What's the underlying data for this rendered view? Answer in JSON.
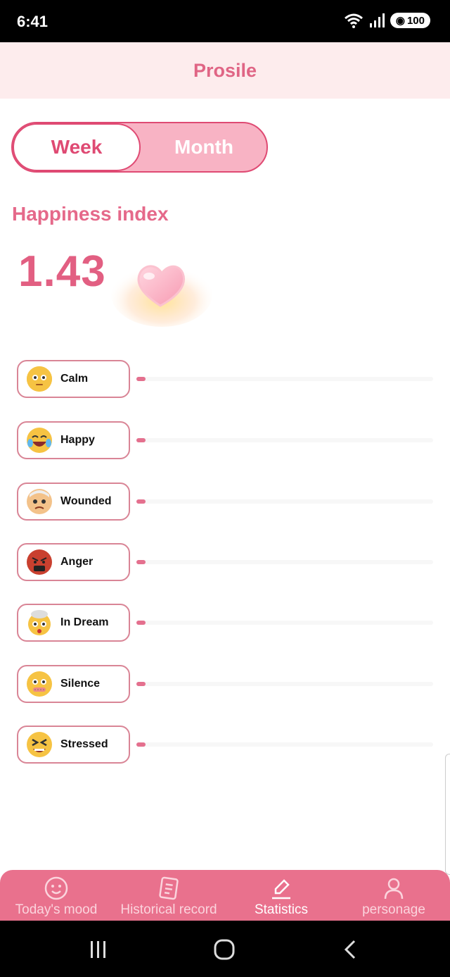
{
  "status": {
    "time": "6:41",
    "battery": "100"
  },
  "header": {
    "title": "Prosile"
  },
  "period_toggle": {
    "week": "Week",
    "month": "Month",
    "selected": "Week"
  },
  "happiness": {
    "title": "Happiness index",
    "value": "1.43"
  },
  "moods": [
    {
      "label": "Calm",
      "icon": "calm-emoji-icon",
      "level": 0.03,
      "color": "#f6c343"
    },
    {
      "label": "Happy",
      "icon": "happy-emoji-icon",
      "level": 0.03,
      "color": "#f6c343"
    },
    {
      "label": "Wounded",
      "icon": "wounded-emoji-icon",
      "level": 0.03,
      "color": "#f3c28a"
    },
    {
      "label": "Anger",
      "icon": "anger-emoji-icon",
      "level": 0.03,
      "color": "#c9402f"
    },
    {
      "label": "In Dream",
      "icon": "in-dream-emoji-icon",
      "level": 0.03,
      "color": "#f6c343"
    },
    {
      "label": "Silence",
      "icon": "silence-emoji-icon",
      "level": 0.03,
      "color": "#f6c343"
    },
    {
      "label": "Stressed",
      "icon": "stressed-emoji-icon",
      "level": 0.03,
      "color": "#f6c343"
    }
  ],
  "nav": [
    {
      "label": "Today's mood",
      "icon": "mood-face-icon",
      "active": false
    },
    {
      "label": "Historical record",
      "icon": "notebook-icon",
      "active": false
    },
    {
      "label": "Statistics",
      "icon": "pencil-edit-icon",
      "active": true
    },
    {
      "label": "personage",
      "icon": "person-icon",
      "active": false
    }
  ],
  "colors": {
    "accent": "#df4a73",
    "header_bg": "#fdeced",
    "nav_bg": "#e9718d"
  }
}
